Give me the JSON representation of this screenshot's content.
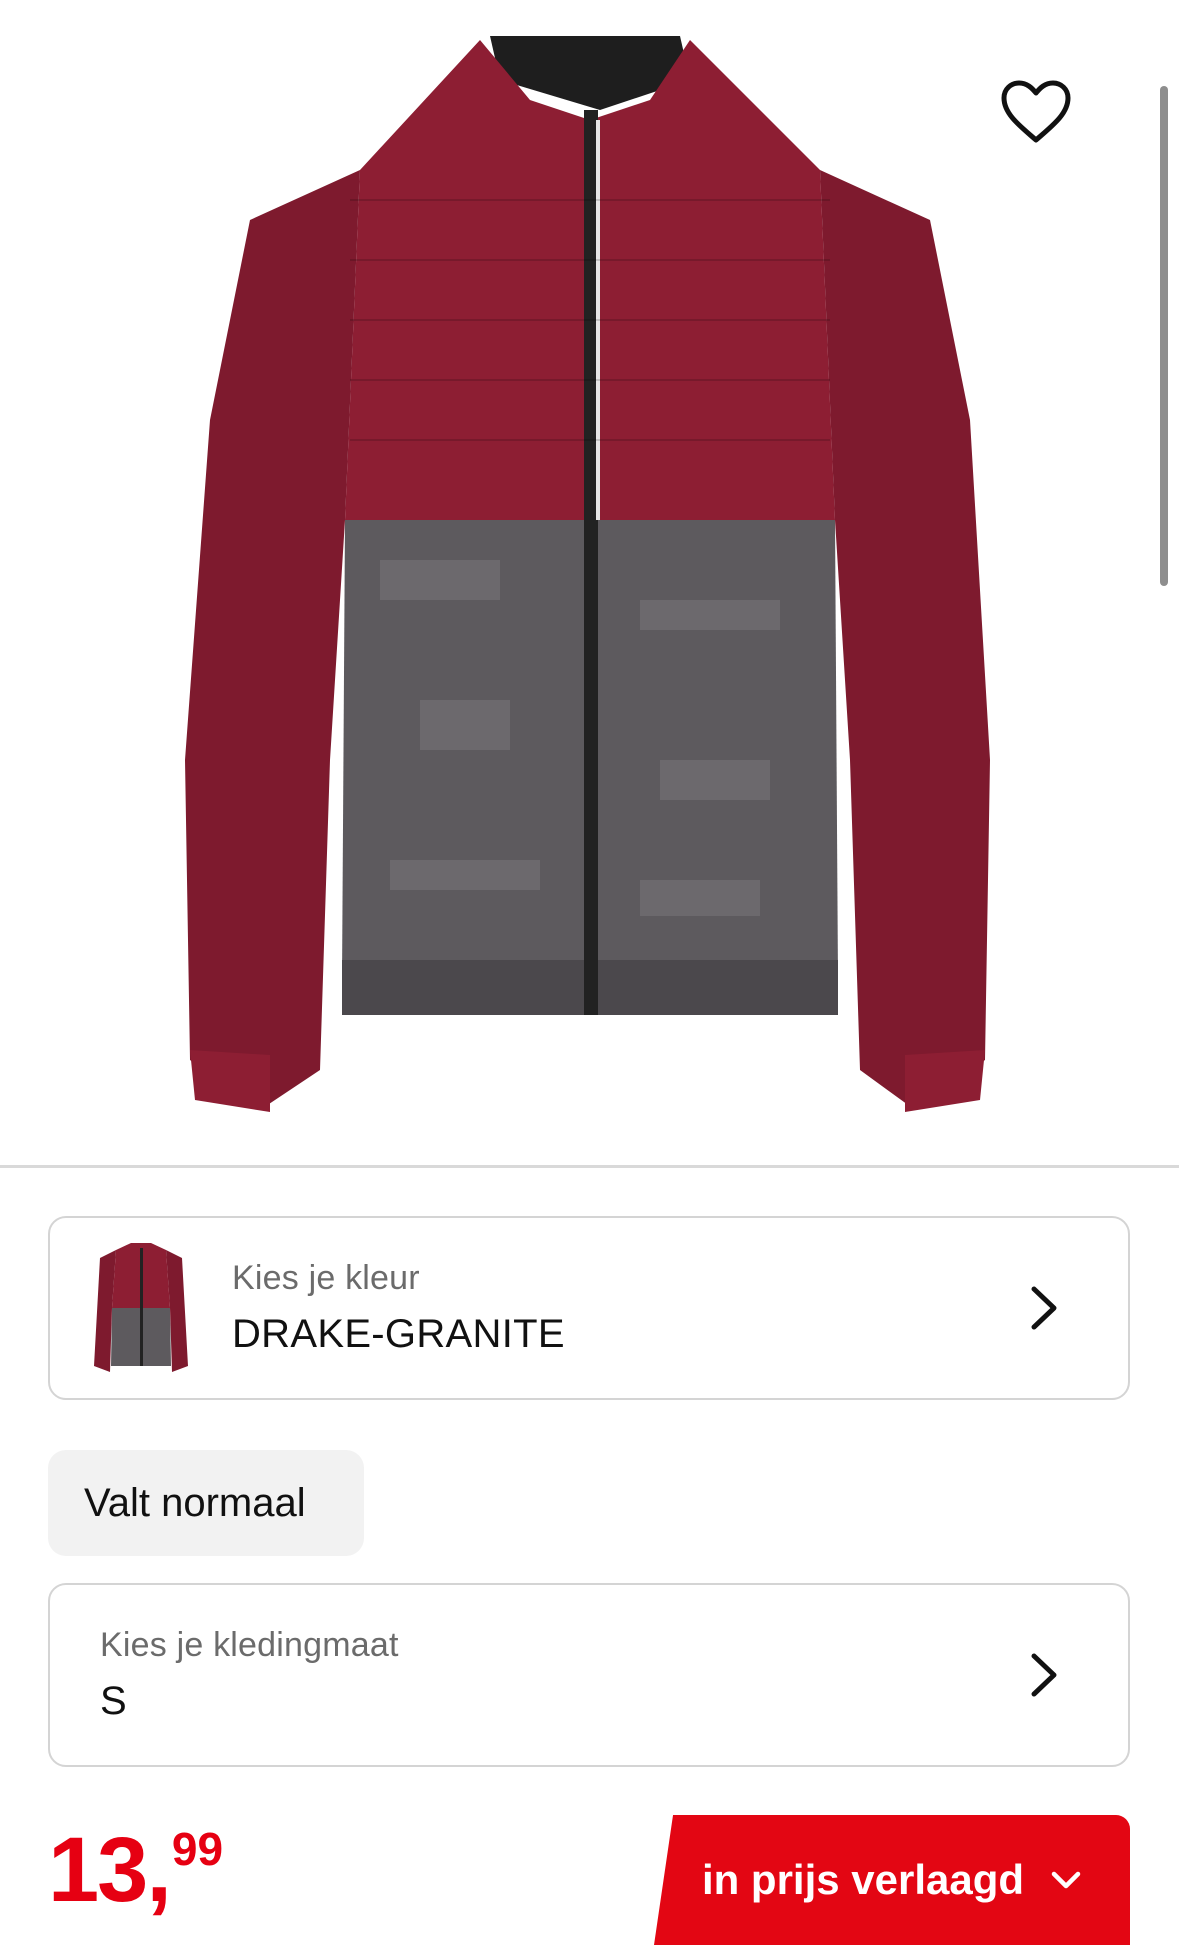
{
  "product": {
    "image_alt": "Craft jacket DRAKE-GRANITE",
    "colors": {
      "burgundy": "#8d1e33",
      "granite": "#5d5a5e",
      "zip": "#222222"
    }
  },
  "icons": {
    "favorite": "heart-outline-icon",
    "chevron": "chevron-right-icon",
    "cta_chevron": "chevron-down-icon"
  },
  "color_selector": {
    "label": "Kies je kleur",
    "value": "DRAKE-GRANITE"
  },
  "fit": {
    "label": "Valt normaal"
  },
  "size_selector": {
    "label": "Kies je kledingmaat",
    "value": "S"
  },
  "price": {
    "main": "13,",
    "cents": "99",
    "color": "#e60012"
  },
  "cta": {
    "label": "in prijs verlaagd",
    "color": "#e30613"
  }
}
